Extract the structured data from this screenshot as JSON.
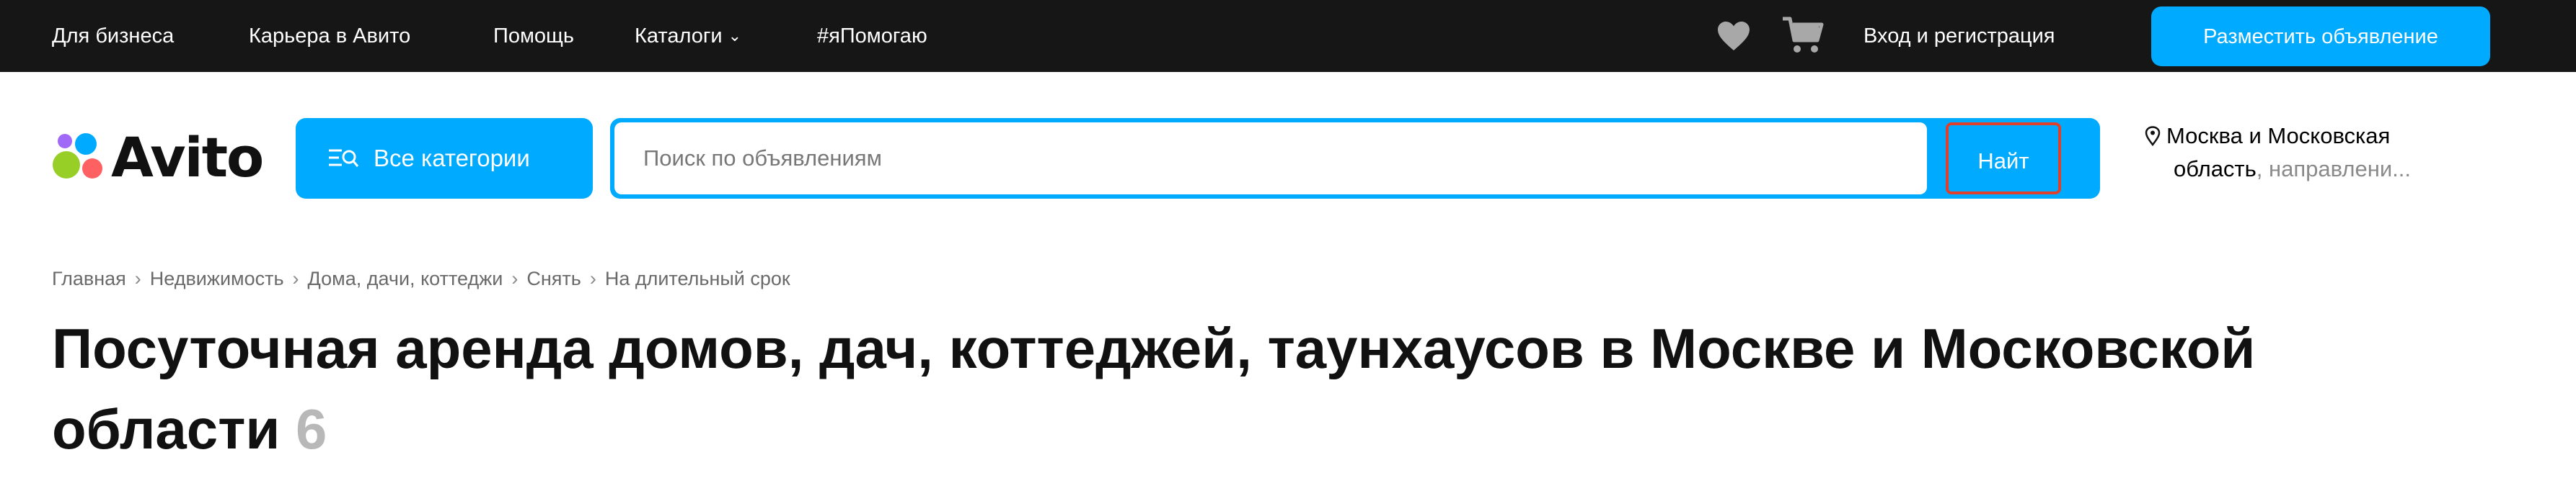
{
  "topbar": {
    "links": [
      "Для бизнеса",
      "Карьера в Авито",
      "Помощь",
      "Каталоги",
      "#яПомогаю"
    ],
    "auth_label": "Вход и регистрация",
    "post_button": "Разместить объявление"
  },
  "header": {
    "logo_text": "Avito",
    "categories_button": "Все категории",
    "search_placeholder": "Поиск по объявлениям",
    "find_button": "Найт",
    "location_line1": "Москва и Московская",
    "location_line2_main": "область",
    "location_line2_muted": ", направлени..."
  },
  "breadcrumb": [
    "Главная",
    "Недвижимость",
    "Дома, дачи, коттеджи",
    "Снять",
    "На длительный срок"
  ],
  "page": {
    "title": "Посуточная аренда домов, дач, коттеджей, таунхаусов в Москве и Московской области",
    "count": "6"
  },
  "colors": {
    "accent": "#00aaff",
    "topbar_bg": "#161616",
    "highlight": "#e0402a"
  },
  "icons": [
    "heart-icon",
    "cart-icon",
    "chevron-down-icon",
    "category-list-icon",
    "location-pin-icon",
    "avito-logo-dots"
  ]
}
